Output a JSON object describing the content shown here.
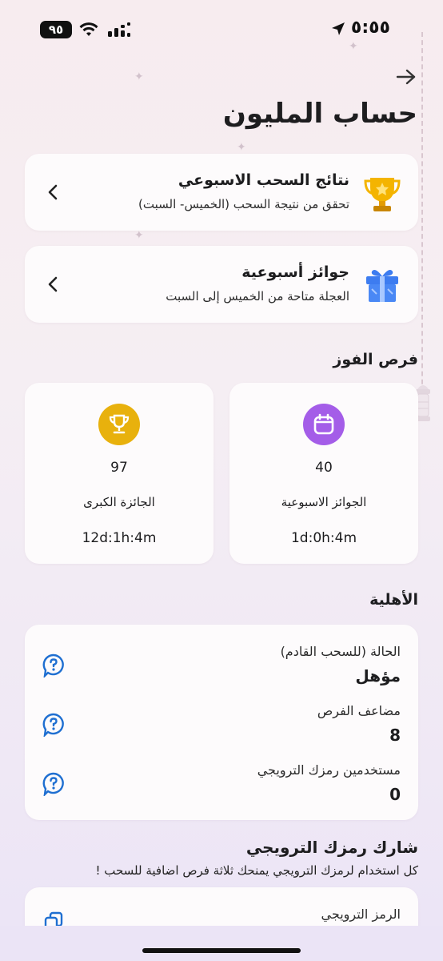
{
  "status": {
    "battery": "٩٥",
    "time": "٥:٥٥"
  },
  "header": {
    "title": "حساب المليون"
  },
  "nav_cards": [
    {
      "title": "نتائج السحب الاسبوعي",
      "subtitle": "تحقق من نتيجة السحب (الخميس- السبت)",
      "icon": "trophy-icon"
    },
    {
      "title": "جوائز أسبوعية",
      "subtitle": "العجلة متاحة من الخميس إلى السبت",
      "icon": "gift-icon"
    }
  ],
  "chances": {
    "title": "فرص الفوز",
    "grand_prize": {
      "value": "97",
      "label": "الجائزة الكبرى",
      "countdown": "12d:1h:4m",
      "color": "#e8b10d",
      "icon": "trophy-icon"
    },
    "weekly_prizes": {
      "value": "40",
      "label": "الجوائز الاسبوعية",
      "countdown": "1d:0h:4m",
      "color": "#a45de8",
      "icon": "calendar-icon"
    }
  },
  "eligibility": {
    "title": "الأهلية",
    "rows": [
      {
        "label": "الحالة (للسحب القادم)",
        "value": "مؤهل"
      },
      {
        "label": "مضاعف الفرص",
        "value": "8"
      },
      {
        "label": "مستخدمين رمزك الترويجي",
        "value": "0"
      }
    ],
    "help_color": "#1f6fd1"
  },
  "share": {
    "title": "شارك رمزك الترويجي",
    "subtitle": "كل استخدام لرمزك الترويجي يمنحك ثلاثة فرص اضافية للسحب !",
    "promo_label": "الرمز الترويجي"
  }
}
